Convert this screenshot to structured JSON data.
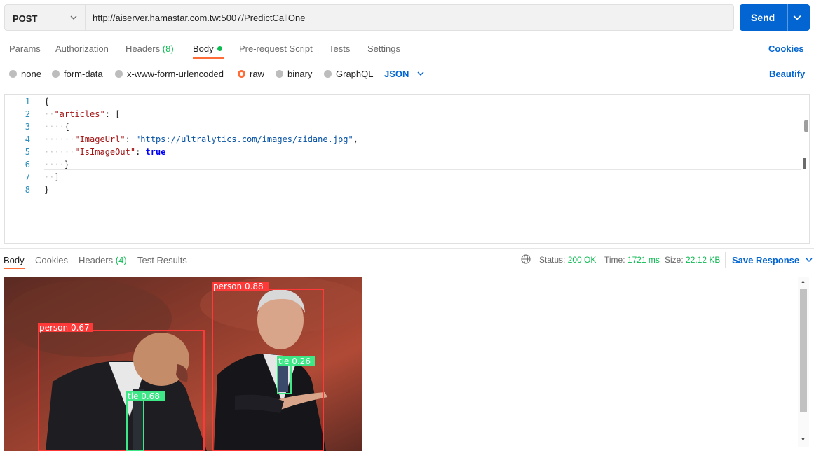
{
  "request": {
    "method": "POST",
    "url": "http://aiserver.hamastar.com.tw:5007/PredictCallOne",
    "send_label": "Send"
  },
  "request_tabs": {
    "params": "Params",
    "authorization": "Authorization",
    "headers": "Headers",
    "headers_count": "(8)",
    "body": "Body",
    "prerequest": "Pre-request Script",
    "tests": "Tests",
    "settings": "Settings",
    "cookies_link": "Cookies"
  },
  "body_types": {
    "none": "none",
    "form_data": "form-data",
    "urlencoded": "x-www-form-urlencoded",
    "raw": "raw",
    "binary": "binary",
    "graphql": "GraphQL",
    "format": "JSON",
    "beautify": "Beautify"
  },
  "editor": {
    "line_numbers": [
      "1",
      "2",
      "3",
      "4",
      "5",
      "6",
      "7",
      "8"
    ],
    "lines": {
      "l1": "{",
      "l2_key": "\"articles\"",
      "l2_rest": ": [",
      "l3": "{",
      "l4_key": "\"ImageUrl\"",
      "l4_colon": ": ",
      "l4_val": "\"https://ultralytics.com/images/zidane.jpg\"",
      "l4_comma": ",",
      "l5_key": "\"IsImageOut\"",
      "l5_colon": ": ",
      "l5_val": "true",
      "l6": "}",
      "l7": "]",
      "l8": "}"
    }
  },
  "response": {
    "tabs": {
      "body": "Body",
      "cookies": "Cookies",
      "headers": "Headers",
      "headers_count": "(4)",
      "test_results": "Test Results"
    },
    "status_label": "Status:",
    "status_value": "200 OK",
    "time_label": "Time:",
    "time_value": "1721 ms",
    "size_label": "Size:",
    "size_value": "22.12 KB",
    "save_label": "Save Response"
  },
  "detections": {
    "person1": "person 0.88",
    "person2": "person 0.67",
    "tie1": "tie 0.26",
    "tie2": "tie 0.68"
  },
  "colors": {
    "accent": "#ff6c37",
    "primary": "#0265d2",
    "success": "#0cbb52",
    "person_box": "#ff3838",
    "tie_box": "#48f90a"
  },
  "icons": {
    "method_dropdown": "chevron-down-icon",
    "send_dropdown": "chevron-down-icon",
    "format_dropdown": "chevron-down-icon",
    "globe": "globe-icon",
    "save_dropdown": "chevron-down-icon"
  }
}
